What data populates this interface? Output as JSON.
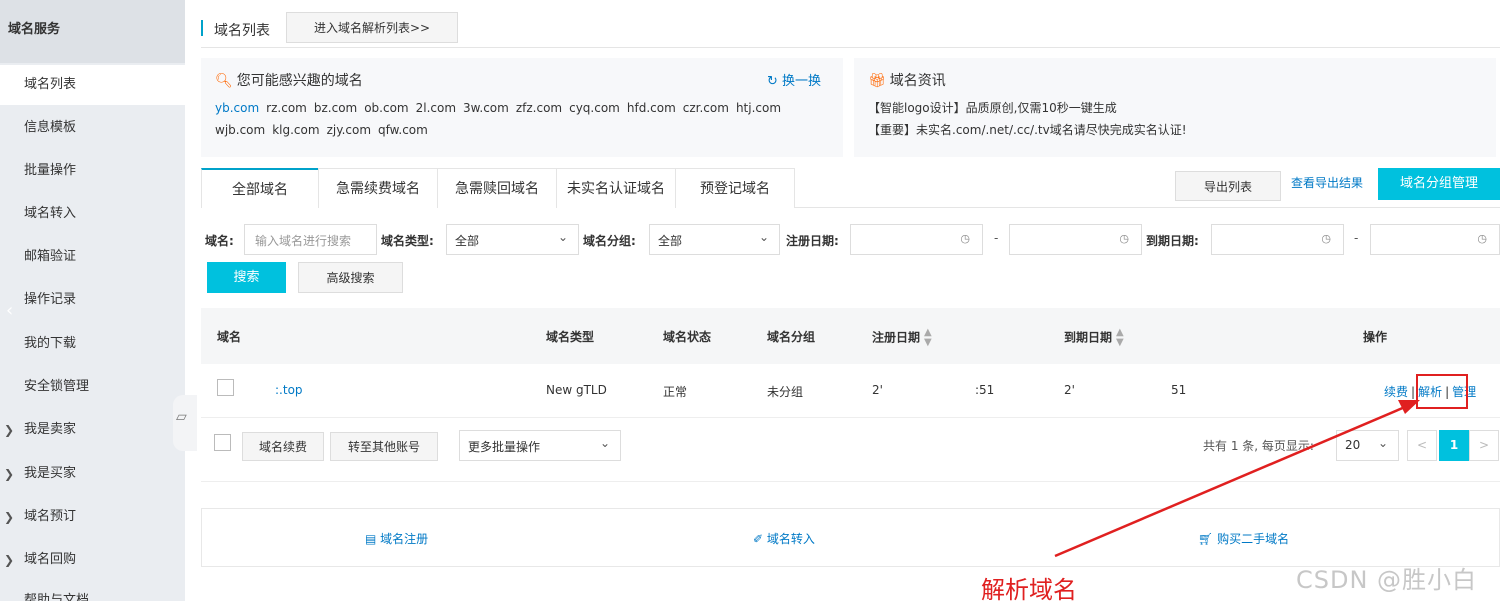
{
  "sidebar": {
    "header": "域名服务",
    "items": [
      {
        "label": "域名列表",
        "expandable": false
      },
      {
        "label": "信息模板",
        "expandable": false
      },
      {
        "label": "批量操作",
        "expandable": false
      },
      {
        "label": "域名转入",
        "expandable": false
      },
      {
        "label": "邮箱验证",
        "expandable": false
      },
      {
        "label": "操作记录",
        "expandable": false
      },
      {
        "label": "我的下载",
        "expandable": false
      },
      {
        "label": "安全锁管理",
        "expandable": false
      },
      {
        "label": "我是卖家",
        "expandable": true
      },
      {
        "label": "我是买家",
        "expandable": true
      },
      {
        "label": "域名预订",
        "expandable": true
      },
      {
        "label": "域名回购",
        "expandable": true
      },
      {
        "label": "帮助与文档",
        "expandable": false
      }
    ]
  },
  "topbar": {
    "title": "域名列表",
    "dns_button": "进入域名解析列表>>"
  },
  "interest": {
    "title": "您可能感兴趣的域名",
    "refresh": "换一换",
    "domains_row1": [
      "yb.com",
      "rz.com",
      "bz.com",
      "ob.com",
      "2l.com",
      "3w.com",
      "zfz.com",
      "cyq.com",
      "hfd.com",
      "czr.com",
      "htj.com"
    ],
    "domains_row2": [
      "wjb.com",
      "klg.com",
      "zjy.com",
      "qfw.com"
    ]
  },
  "news": {
    "title": "域名资讯",
    "line1": "【智能logo设计】品质原创,仅需10秒一键生成",
    "line2": "【重要】未实名.com/.net/.cc/.tv域名请尽快完成实名认证!"
  },
  "tabs": [
    "全部域名",
    "急需续费域名",
    "急需赎回域名",
    "未实名认证域名",
    "预登记域名"
  ],
  "actions": {
    "export": "导出列表",
    "view_export": "查看导出结果",
    "group_manage": "域名分组管理"
  },
  "filter": {
    "domain_label": "域名:",
    "domain_placeholder": "输入域名进行搜索",
    "type_label": "域名类型:",
    "type_value": "全部",
    "group_label": "域名分组:",
    "group_value": "全部",
    "reg_label": "注册日期:",
    "exp_label": "到期日期:",
    "dash": "-",
    "search": "搜索",
    "advanced": "高级搜索"
  },
  "table": {
    "headers": {
      "domain": "域名",
      "type": "域名类型",
      "status": "域名状态",
      "group": "域名分组",
      "reg_date": "注册日期",
      "exp_date": "到期日期",
      "ops": "操作"
    },
    "rows": [
      {
        "domain": ":.top",
        "type": "New gTLD",
        "status": "正常",
        "group": "未分组",
        "reg_date_a": "2'",
        "reg_date_b": ":51",
        "exp_date_a": "2'",
        "exp_date_b": "51",
        "op_renew": "续费",
        "op_resolve": "解析",
        "op_manage": "管理",
        "sep": "|"
      }
    ]
  },
  "bottombar": {
    "renew": "域名续费",
    "transfer": "转至其他账号",
    "more": "更多批量操作",
    "total_text": "共有 1 条, 每页显示:",
    "page_size": "20",
    "prev": "<",
    "page": "1",
    "next": ">"
  },
  "quicklinks": {
    "register": "域名注册",
    "transfer_in": "域名转入",
    "buy_second": "购买二手域名"
  },
  "annotation": {
    "label": "解析域名",
    "color": "#e02020"
  },
  "watermark": "CSDN @胜小白",
  "colors": {
    "accent": "#00c1de",
    "link": "#0079c6",
    "sidebar_bg": "#eaedf1"
  }
}
